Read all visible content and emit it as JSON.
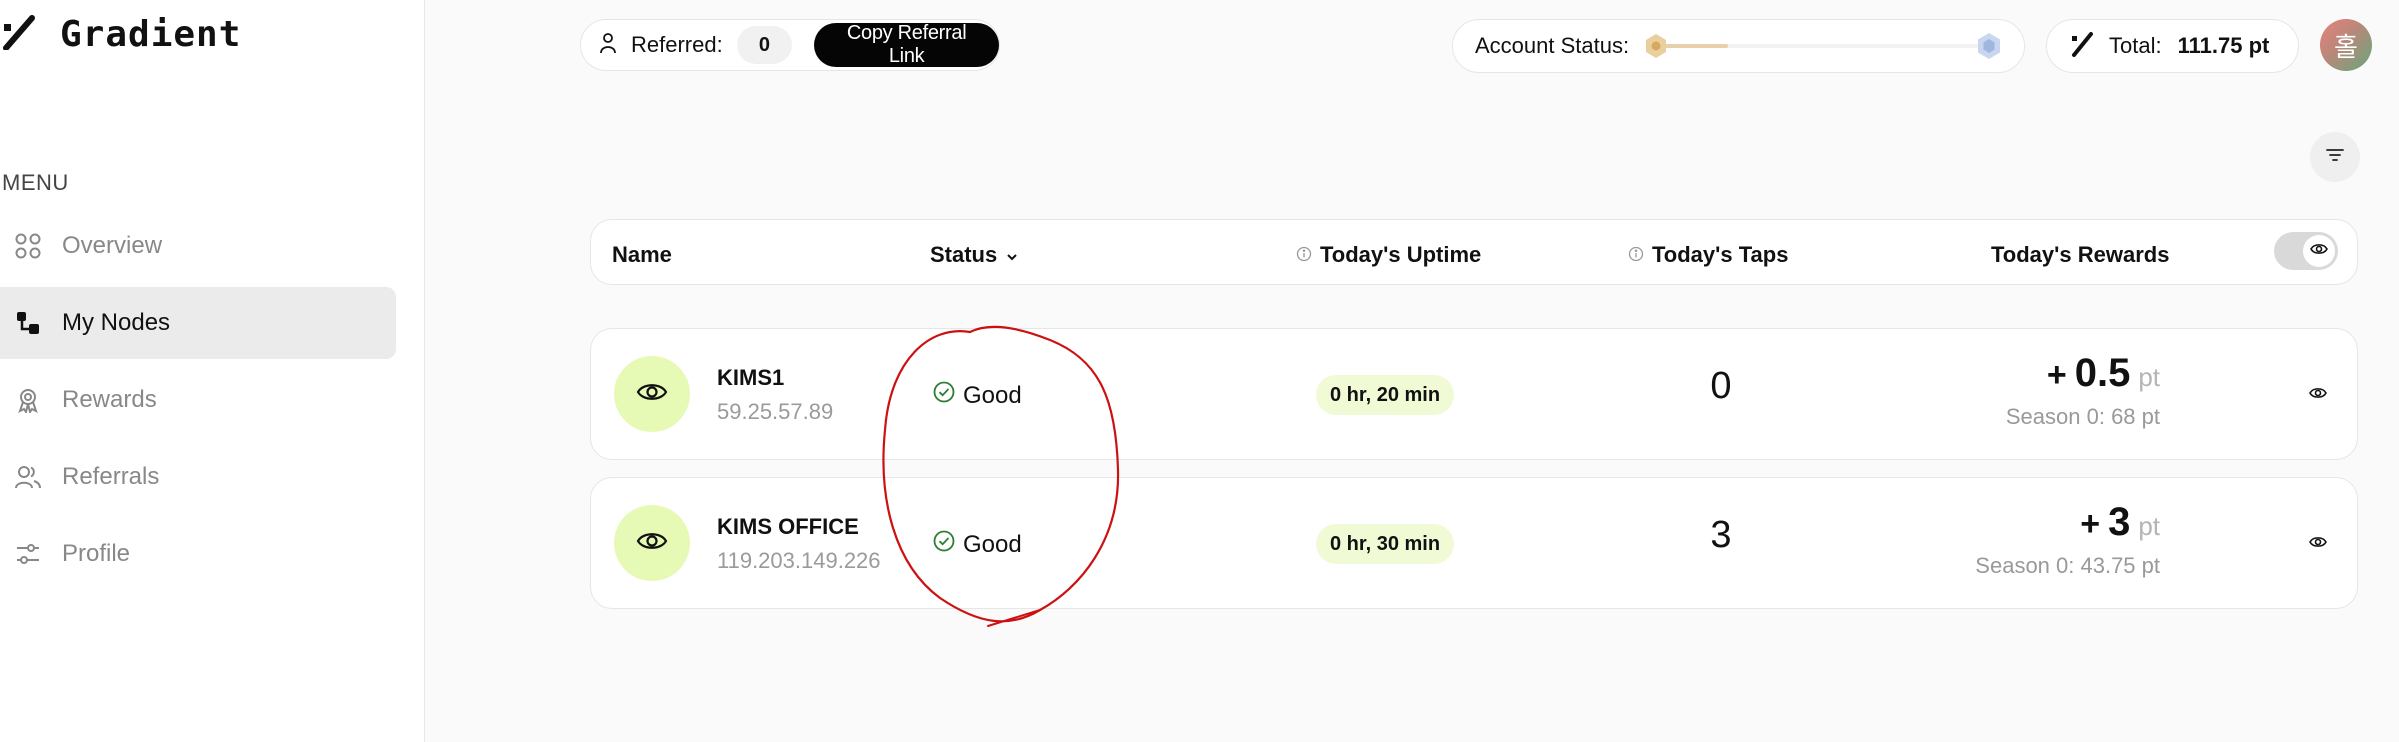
{
  "app": {
    "logo_text": "Gradient"
  },
  "sidebar": {
    "menu_heading": "MENU",
    "items": [
      {
        "label": "Overview",
        "icon": "grid-icon",
        "active": false
      },
      {
        "label": "My Nodes",
        "icon": "nodes-icon",
        "active": true
      },
      {
        "label": "Rewards",
        "icon": "award-icon",
        "active": false
      },
      {
        "label": "Referrals",
        "icon": "users-icon",
        "active": false
      },
      {
        "label": "Profile",
        "icon": "sliders-icon",
        "active": false
      }
    ]
  },
  "topbar": {
    "referred_label": "Referred:",
    "referred_count": "0",
    "copy_referral_label": "Copy Referral Link",
    "account_status_label": "Account Status:",
    "account_progress": 0.22,
    "total_label": "Total:",
    "total_value": "111.75 pt",
    "avatar_initial": "홀"
  },
  "table": {
    "headers": {
      "name": "Name",
      "status": "Status",
      "uptime": "Today's Uptime",
      "taps": "Today's Taps",
      "rewards": "Today's Rewards"
    },
    "rows": [
      {
        "name": "KIMS1",
        "ip": "59.25.57.89",
        "status": "Good",
        "uptime": "0 hr, 20 min",
        "taps": "0",
        "reward_sign": "+",
        "reward_value": "0.5",
        "reward_unit": "pt",
        "season": "Season 0: 68 pt"
      },
      {
        "name": "KIMS OFFICE",
        "ip": "119.203.149.226",
        "status": "Good",
        "uptime": "0 hr, 30 min",
        "taps": "3",
        "reward_sign": "+",
        "reward_value": "3",
        "reward_unit": "pt",
        "season": "Season 0: 43.75 pt"
      }
    ]
  },
  "colors": {
    "accent_green": "#e6f9b5",
    "uptime_bg": "#f0fbd6",
    "status_green": "#2e7d32",
    "annotation_red": "#cc1111"
  }
}
